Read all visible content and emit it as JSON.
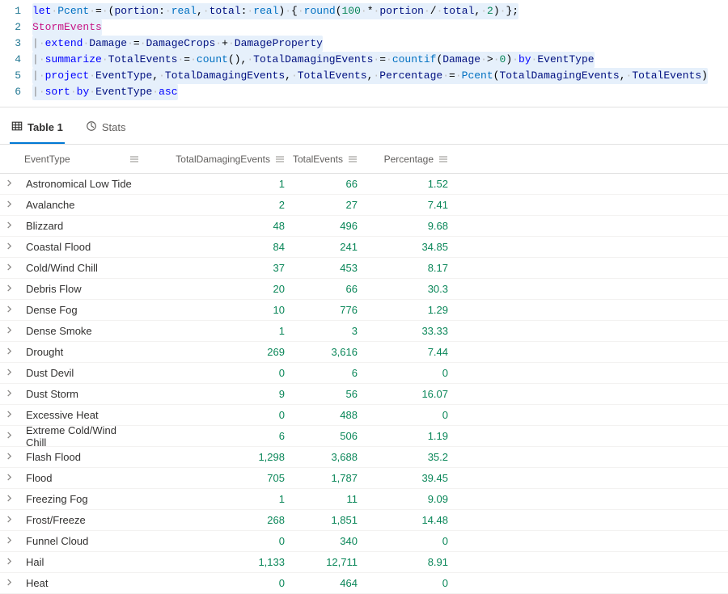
{
  "editor": {
    "lines": [
      {
        "n": 1,
        "tokens": [
          {
            "t": "let ",
            "c": "kw"
          },
          {
            "t": "Pcent",
            "c": "fn"
          },
          {
            "t": " = (",
            "c": "op"
          },
          {
            "t": "portion",
            "c": "id"
          },
          {
            "t": ": ",
            "c": "op"
          },
          {
            "t": "real",
            "c": "typ"
          },
          {
            "t": ", ",
            "c": "op"
          },
          {
            "t": "total",
            "c": "id"
          },
          {
            "t": ": ",
            "c": "op"
          },
          {
            "t": "real",
            "c": "typ"
          },
          {
            "t": ") { ",
            "c": "op"
          },
          {
            "t": "round",
            "c": "fn"
          },
          {
            "t": "(",
            "c": "op"
          },
          {
            "t": "100",
            "c": "num"
          },
          {
            "t": " * ",
            "c": "op"
          },
          {
            "t": "portion",
            "c": "id"
          },
          {
            "t": " / ",
            "c": "op"
          },
          {
            "t": "total",
            "c": "id"
          },
          {
            "t": ", ",
            "c": "op"
          },
          {
            "t": "2",
            "c": "num"
          },
          {
            "t": ") };",
            "c": "op"
          }
        ]
      },
      {
        "n": 2,
        "tokens": [
          {
            "t": "StormEvents",
            "c": "tbl"
          }
        ]
      },
      {
        "n": 3,
        "tokens": [
          {
            "t": "|",
            "c": "pipe"
          },
          {
            "t": " ",
            "c": "op"
          },
          {
            "t": "extend",
            "c": "cmd"
          },
          {
            "t": " ",
            "c": "op"
          },
          {
            "t": "Damage",
            "c": "id"
          },
          {
            "t": " = ",
            "c": "op"
          },
          {
            "t": "DamageCrops",
            "c": "id"
          },
          {
            "t": " + ",
            "c": "op"
          },
          {
            "t": "DamageProperty",
            "c": "id"
          }
        ]
      },
      {
        "n": 4,
        "tokens": [
          {
            "t": "|",
            "c": "pipe"
          },
          {
            "t": " ",
            "c": "op"
          },
          {
            "t": "summarize",
            "c": "cmd"
          },
          {
            "t": " ",
            "c": "op"
          },
          {
            "t": "TotalEvents",
            "c": "id"
          },
          {
            "t": " = ",
            "c": "op"
          },
          {
            "t": "count",
            "c": "fn"
          },
          {
            "t": "(), ",
            "c": "op"
          },
          {
            "t": "TotalDamagingEvents",
            "c": "id"
          },
          {
            "t": " = ",
            "c": "op"
          },
          {
            "t": "countif",
            "c": "fn"
          },
          {
            "t": "(",
            "c": "op"
          },
          {
            "t": "Damage",
            "c": "id"
          },
          {
            "t": " > ",
            "c": "op"
          },
          {
            "t": "0",
            "c": "num"
          },
          {
            "t": ") ",
            "c": "op"
          },
          {
            "t": "by",
            "c": "cmd"
          },
          {
            "t": " ",
            "c": "op"
          },
          {
            "t": "EventType",
            "c": "id"
          }
        ]
      },
      {
        "n": 5,
        "tokens": [
          {
            "t": "|",
            "c": "pipe"
          },
          {
            "t": " ",
            "c": "op"
          },
          {
            "t": "project",
            "c": "cmd"
          },
          {
            "t": " ",
            "c": "op"
          },
          {
            "t": "EventType",
            "c": "id"
          },
          {
            "t": ", ",
            "c": "op"
          },
          {
            "t": "TotalDamagingEvents",
            "c": "id"
          },
          {
            "t": ", ",
            "c": "op"
          },
          {
            "t": "TotalEvents",
            "c": "id"
          },
          {
            "t": ", ",
            "c": "op"
          },
          {
            "t": "Percentage",
            "c": "id"
          },
          {
            "t": " = ",
            "c": "op"
          },
          {
            "t": "Pcent",
            "c": "fn"
          },
          {
            "t": "(",
            "c": "op"
          },
          {
            "t": "TotalDamagingEvents",
            "c": "id"
          },
          {
            "t": ", ",
            "c": "op"
          },
          {
            "t": "TotalEvents",
            "c": "id"
          },
          {
            "t": ")",
            "c": "op"
          }
        ]
      },
      {
        "n": 6,
        "tokens": [
          {
            "t": "|",
            "c": "pipe"
          },
          {
            "t": " ",
            "c": "op"
          },
          {
            "t": "sort",
            "c": "cmd"
          },
          {
            "t": " ",
            "c": "op"
          },
          {
            "t": "by",
            "c": "cmd"
          },
          {
            "t": " ",
            "c": "op"
          },
          {
            "t": "EventType",
            "c": "id"
          },
          {
            "t": " ",
            "c": "op"
          },
          {
            "t": "asc",
            "c": "cmd"
          }
        ]
      }
    ]
  },
  "tabs": {
    "table_label": "Table 1",
    "stats_label": "Stats"
  },
  "columns": {
    "event": "EventType",
    "damaging": "TotalDamagingEvents",
    "total": "TotalEvents",
    "pct": "Percentage"
  },
  "rows": [
    {
      "event": "Astronomical Low Tide",
      "damaging": "1",
      "total": "66",
      "pct": "1.52"
    },
    {
      "event": "Avalanche",
      "damaging": "2",
      "total": "27",
      "pct": "7.41"
    },
    {
      "event": "Blizzard",
      "damaging": "48",
      "total": "496",
      "pct": "9.68"
    },
    {
      "event": "Coastal Flood",
      "damaging": "84",
      "total": "241",
      "pct": "34.85"
    },
    {
      "event": "Cold/Wind Chill",
      "damaging": "37",
      "total": "453",
      "pct": "8.17"
    },
    {
      "event": "Debris Flow",
      "damaging": "20",
      "total": "66",
      "pct": "30.3"
    },
    {
      "event": "Dense Fog",
      "damaging": "10",
      "total": "776",
      "pct": "1.29"
    },
    {
      "event": "Dense Smoke",
      "damaging": "1",
      "total": "3",
      "pct": "33.33"
    },
    {
      "event": "Drought",
      "damaging": "269",
      "total": "3,616",
      "pct": "7.44"
    },
    {
      "event": "Dust Devil",
      "damaging": "0",
      "total": "6",
      "pct": "0"
    },
    {
      "event": "Dust Storm",
      "damaging": "9",
      "total": "56",
      "pct": "16.07"
    },
    {
      "event": "Excessive Heat",
      "damaging": "0",
      "total": "488",
      "pct": "0"
    },
    {
      "event": "Extreme Cold/Wind Chill",
      "damaging": "6",
      "total": "506",
      "pct": "1.19"
    },
    {
      "event": "Flash Flood",
      "damaging": "1,298",
      "total": "3,688",
      "pct": "35.2"
    },
    {
      "event": "Flood",
      "damaging": "705",
      "total": "1,787",
      "pct": "39.45"
    },
    {
      "event": "Freezing Fog",
      "damaging": "1",
      "total": "11",
      "pct": "9.09"
    },
    {
      "event": "Frost/Freeze",
      "damaging": "268",
      "total": "1,851",
      "pct": "14.48"
    },
    {
      "event": "Funnel Cloud",
      "damaging": "0",
      "total": "340",
      "pct": "0"
    },
    {
      "event": "Hail",
      "damaging": "1,133",
      "total": "12,711",
      "pct": "8.91"
    },
    {
      "event": "Heat",
      "damaging": "0",
      "total": "464",
      "pct": "0"
    }
  ]
}
